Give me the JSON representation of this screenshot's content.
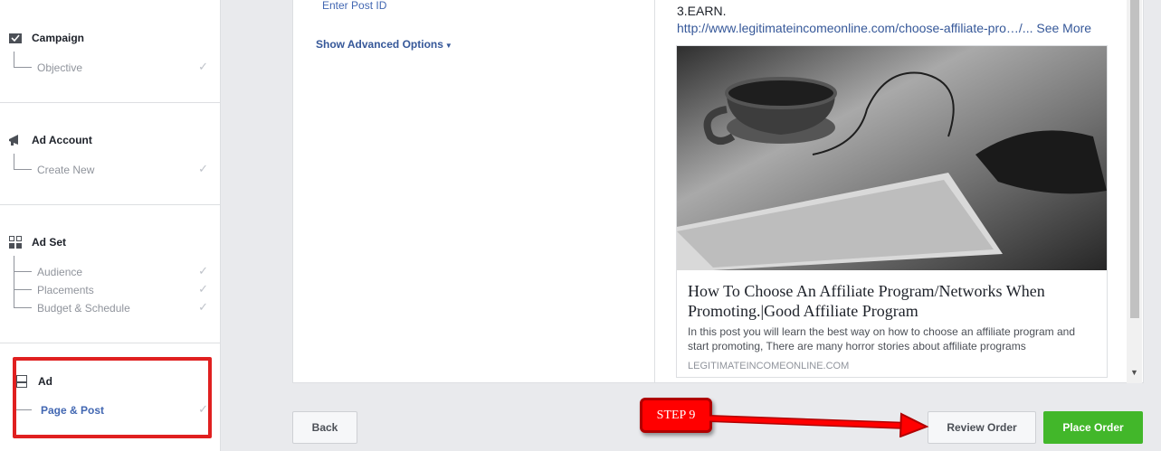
{
  "sidebar": {
    "campaign": {
      "title": "Campaign",
      "items": [
        {
          "label": "Objective"
        }
      ]
    },
    "ad_account": {
      "title": "Ad Account",
      "items": [
        {
          "label": "Create New"
        }
      ]
    },
    "ad_set": {
      "title": "Ad Set",
      "items": [
        {
          "label": "Audience"
        },
        {
          "label": "Placements"
        },
        {
          "label": "Budget & Schedule"
        }
      ]
    },
    "ad": {
      "title": "Ad",
      "items": [
        {
          "label": "Page & Post"
        }
      ]
    }
  },
  "form": {
    "post_id_label": "Enter Post ID",
    "advanced_label": "Show Advanced Options"
  },
  "preview": {
    "text": "3.EARN.",
    "link": "http://www.legitimateincomeonline.com/choose-affiliate-pro…/...",
    "see_more": "See More",
    "card_title": "How To Choose An Affiliate Program/Networks When Promoting.|Good Affiliate Program",
    "card_desc": "In this post you will learn the best way on how to choose an affiliate program and start promoting, There are many horror stories about affiliate programs",
    "card_domain": "LEGITIMATEINCOMEONLINE.COM"
  },
  "buttons": {
    "back": "Back",
    "review": "Review Order",
    "place": "Place Order"
  },
  "annotation": {
    "step": "STEP 9"
  },
  "colors": {
    "accent": "#4267b2",
    "success": "#42b72a",
    "annotation": "#ff0000"
  }
}
